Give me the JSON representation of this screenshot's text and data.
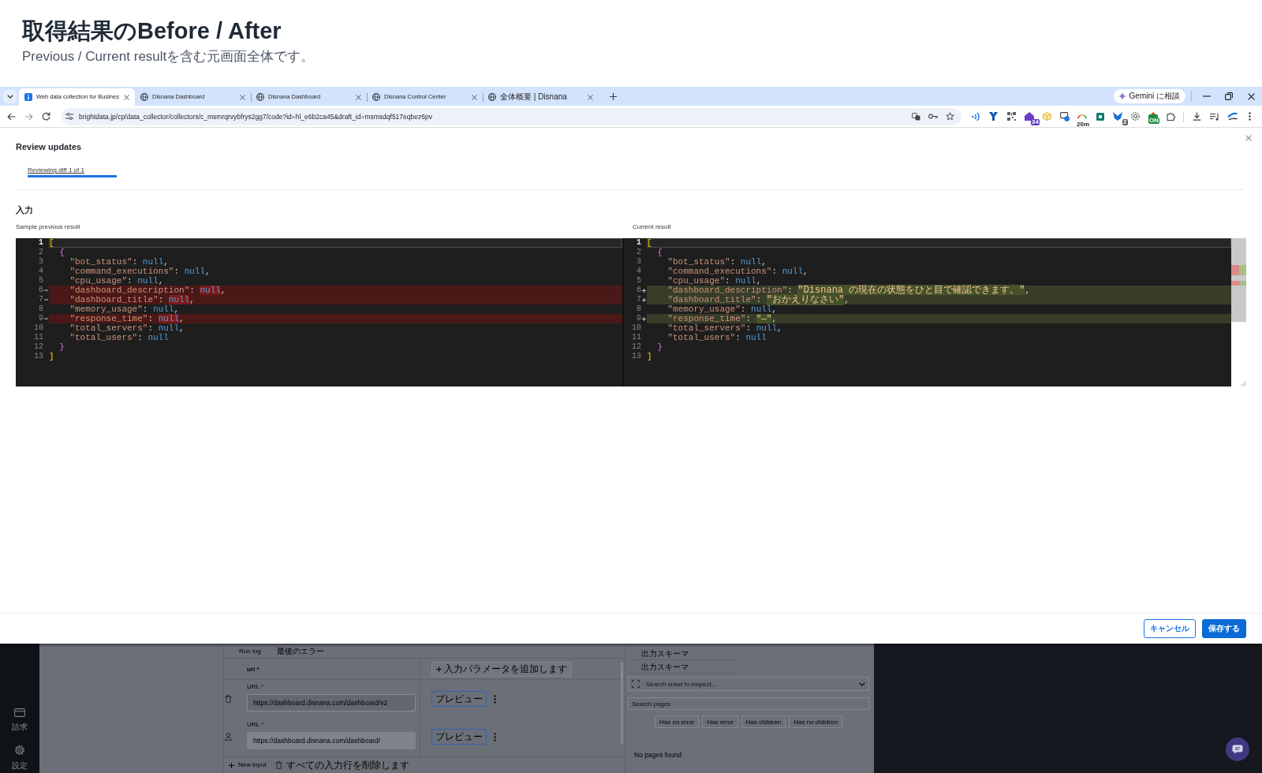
{
  "header": {
    "title": "取得結果のBefore / After",
    "subtitle": "Previous / Current resultを含む元画面全体です。"
  },
  "browser": {
    "tabs": [
      {
        "title": "Web data collection for Busines",
        "kind": "info",
        "selected": true
      },
      {
        "title": "Disnana Dashboard",
        "kind": "globe",
        "selected": false
      },
      {
        "title": "Disnana Dashboard",
        "kind": "globe",
        "selected": false
      },
      {
        "title": "Disnana Control Center",
        "kind": "globe",
        "selected": false
      },
      {
        "title": "全体概要 | Disnana",
        "kind": "globe",
        "selected": false
      }
    ],
    "assistant_button": "Gemini に相談",
    "url": "brightdata.jp/cp/data_collector/collectors/c_msmrqrvybfrys2gg7/code?id=hl_e6b2ca45&draft_id=msmsdqf517eqbez6pv",
    "extensions": [
      {
        "kind": "signal"
      },
      {
        "kind": "funnel"
      },
      {
        "kind": "qr"
      },
      {
        "kind": "house",
        "badge": "34"
      },
      {
        "kind": "box"
      },
      {
        "kind": "monitor"
      },
      {
        "kind": "gauge",
        "badge": "20m"
      },
      {
        "kind": "square"
      },
      {
        "kind": "butterfly",
        "badge": "2"
      },
      {
        "kind": "flower"
      },
      {
        "kind": "toggle",
        "badge": "ON"
      },
      {
        "kind": "puzzle"
      }
    ]
  },
  "modal": {
    "title": "Review updates",
    "tabs": [
      {
        "label": "Reviewing diff 1 of 1",
        "selected": true
      }
    ],
    "section_title": "入力",
    "panes": [
      {
        "label": "Sample previous result",
        "lines": [
          {
            "number": "1",
            "current": true,
            "kind": "unchanged",
            "tokens": [
              {
                "kind": "bracket",
                "text": "[",
                "highlight": false
              }
            ]
          },
          {
            "number": "2",
            "current": false,
            "kind": "unchanged",
            "tokens": [
              {
                "kind": "brace",
                "text": "  {",
                "highlight": false
              }
            ]
          },
          {
            "number": "3",
            "current": false,
            "kind": "unchanged",
            "tokens": [
              {
                "kind": "key",
                "text": "    \"bot_status\"",
                "highlight": false
              },
              {
                "kind": "punct",
                "text": ": ",
                "highlight": false
              },
              {
                "kind": "null",
                "text": "null",
                "highlight": false
              },
              {
                "kind": "punct",
                "text": ",",
                "highlight": false
              }
            ]
          },
          {
            "number": "4",
            "current": false,
            "kind": "unchanged",
            "tokens": [
              {
                "kind": "key",
                "text": "    \"command_executions\"",
                "highlight": false
              },
              {
                "kind": "punct",
                "text": ": ",
                "highlight": false
              },
              {
                "kind": "null",
                "text": "null",
                "highlight": false
              },
              {
                "kind": "punct",
                "text": ",",
                "highlight": false
              }
            ]
          },
          {
            "number": "5",
            "current": false,
            "kind": "unchanged",
            "tokens": [
              {
                "kind": "key",
                "text": "    \"cpu_usage\"",
                "highlight": false
              },
              {
                "kind": "punct",
                "text": ": ",
                "highlight": false
              },
              {
                "kind": "null",
                "text": "null",
                "highlight": false
              },
              {
                "kind": "punct",
                "text": ",",
                "highlight": false
              }
            ]
          },
          {
            "number": "6",
            "current": false,
            "kind": "removed",
            "tokens": [
              {
                "kind": "key",
                "text": "    \"dashboard_description\"",
                "highlight": false
              },
              {
                "kind": "punct",
                "text": ": ",
                "highlight": false
              },
              {
                "kind": "null",
                "text": "null",
                "highlight": true
              },
              {
                "kind": "punct",
                "text": ",",
                "highlight": false
              }
            ]
          },
          {
            "number": "7",
            "current": false,
            "kind": "removed",
            "tokens": [
              {
                "kind": "key",
                "text": "    \"dashboard_title\"",
                "highlight": false
              },
              {
                "kind": "punct",
                "text": ": ",
                "highlight": false
              },
              {
                "kind": "null",
                "text": "null",
                "highlight": true
              },
              {
                "kind": "punct",
                "text": ",",
                "highlight": false
              }
            ]
          },
          {
            "number": "8",
            "current": false,
            "kind": "unchanged",
            "tokens": [
              {
                "kind": "key",
                "text": "    \"memory_usage\"",
                "highlight": false
              },
              {
                "kind": "punct",
                "text": ": ",
                "highlight": false
              },
              {
                "kind": "null",
                "text": "null",
                "highlight": false
              },
              {
                "kind": "punct",
                "text": ",",
                "highlight": false
              }
            ]
          },
          {
            "number": "9",
            "current": false,
            "kind": "removed",
            "tokens": [
              {
                "kind": "key",
                "text": "    \"response_time\"",
                "highlight": false
              },
              {
                "kind": "punct",
                "text": ": ",
                "highlight": false
              },
              {
                "kind": "null",
                "text": "null",
                "highlight": true
              },
              {
                "kind": "punct",
                "text": ",",
                "highlight": false
              }
            ]
          },
          {
            "number": "10",
            "current": false,
            "kind": "unchanged",
            "tokens": [
              {
                "kind": "key",
                "text": "    \"total_servers\"",
                "highlight": false
              },
              {
                "kind": "punct",
                "text": ": ",
                "highlight": false
              },
              {
                "kind": "null",
                "text": "null",
                "highlight": false
              },
              {
                "kind": "punct",
                "text": ",",
                "highlight": false
              }
            ]
          },
          {
            "number": "11",
            "current": false,
            "kind": "unchanged",
            "tokens": [
              {
                "kind": "key",
                "text": "    \"total_users\"",
                "highlight": false
              },
              {
                "kind": "punct",
                "text": ": ",
                "highlight": false
              },
              {
                "kind": "null",
                "text": "null",
                "highlight": false
              }
            ]
          },
          {
            "number": "12",
            "current": false,
            "kind": "unchanged",
            "tokens": [
              {
                "kind": "brace",
                "text": "  }",
                "highlight": false
              }
            ]
          },
          {
            "number": "13",
            "current": false,
            "kind": "unchanged",
            "tokens": [
              {
                "kind": "bracket",
                "text": "]",
                "highlight": false
              }
            ]
          }
        ]
      },
      {
        "label": "Current result",
        "lines": [
          {
            "number": "1",
            "current": true,
            "kind": "unchanged",
            "tokens": [
              {
                "kind": "bracket",
                "text": "[",
                "highlight": false
              }
            ]
          },
          {
            "number": "2",
            "current": false,
            "kind": "unchanged",
            "tokens": [
              {
                "kind": "brace",
                "text": "  {",
                "highlight": false
              }
            ]
          },
          {
            "number": "3",
            "current": false,
            "kind": "unchanged",
            "tokens": [
              {
                "kind": "key",
                "text": "    \"bot_status\"",
                "highlight": false
              },
              {
                "kind": "punct",
                "text": ": ",
                "highlight": false
              },
              {
                "kind": "null",
                "text": "null",
                "highlight": false
              },
              {
                "kind": "punct",
                "text": ",",
                "highlight": false
              }
            ]
          },
          {
            "number": "4",
            "current": false,
            "kind": "unchanged",
            "tokens": [
              {
                "kind": "key",
                "text": "    \"command_executions\"",
                "highlight": false
              },
              {
                "kind": "punct",
                "text": ": ",
                "highlight": false
              },
              {
                "kind": "null",
                "text": "null",
                "highlight": false
              },
              {
                "kind": "punct",
                "text": ",",
                "highlight": false
              }
            ]
          },
          {
            "number": "5",
            "current": false,
            "kind": "unchanged",
            "tokens": [
              {
                "kind": "key",
                "text": "    \"cpu_usage\"",
                "highlight": false
              },
              {
                "kind": "punct",
                "text": ": ",
                "highlight": false
              },
              {
                "kind": "null",
                "text": "null",
                "highlight": false
              },
              {
                "kind": "punct",
                "text": ",",
                "highlight": false
              }
            ]
          },
          {
            "number": "6",
            "current": false,
            "kind": "added",
            "tokens": [
              {
                "kind": "key",
                "text": "    \"dashboard_description\"",
                "highlight": false
              },
              {
                "kind": "punct",
                "text": ": ",
                "highlight": false
              },
              {
                "kind": "string",
                "text": "\"Disnana の現在の状態をひと目で確認できます。\"",
                "highlight": true
              },
              {
                "kind": "punct",
                "text": ",",
                "highlight": false
              }
            ]
          },
          {
            "number": "7",
            "current": false,
            "kind": "added",
            "tokens": [
              {
                "kind": "key",
                "text": "    \"dashboard_title\"",
                "highlight": false
              },
              {
                "kind": "punct",
                "text": ": ",
                "highlight": false
              },
              {
                "kind": "string",
                "text": "\"おかえりなさい\"",
                "highlight": true
              },
              {
                "kind": "punct",
                "text": ",",
                "highlight": false
              }
            ]
          },
          {
            "number": "8",
            "current": false,
            "kind": "unchanged",
            "tokens": [
              {
                "kind": "key",
                "text": "    \"memory_usage\"",
                "highlight": false
              },
              {
                "kind": "punct",
                "text": ": ",
                "highlight": false
              },
              {
                "kind": "null",
                "text": "null",
                "highlight": false
              },
              {
                "kind": "punct",
                "text": ",",
                "highlight": false
              }
            ]
          },
          {
            "number": "9",
            "current": false,
            "kind": "added",
            "tokens": [
              {
                "kind": "key",
                "text": "    \"response_time\"",
                "highlight": false
              },
              {
                "kind": "punct",
                "text": ": ",
                "highlight": false
              },
              {
                "kind": "string",
                "text": "\"—\"",
                "highlight": true
              },
              {
                "kind": "punct",
                "text": ",",
                "highlight": false
              }
            ]
          },
          {
            "number": "10",
            "current": false,
            "kind": "unchanged",
            "tokens": [
              {
                "kind": "key",
                "text": "    \"total_servers\"",
                "highlight": false
              },
              {
                "kind": "punct",
                "text": ": ",
                "highlight": false
              },
              {
                "kind": "null",
                "text": "null",
                "highlight": false
              },
              {
                "kind": "punct",
                "text": ",",
                "highlight": false
              }
            ]
          },
          {
            "number": "11",
            "current": false,
            "kind": "unchanged",
            "tokens": [
              {
                "kind": "key",
                "text": "    \"total_users\"",
                "highlight": false
              },
              {
                "kind": "punct",
                "text": ": ",
                "highlight": false
              },
              {
                "kind": "null",
                "text": "null",
                "highlight": false
              }
            ]
          },
          {
            "number": "12",
            "current": false,
            "kind": "unchanged",
            "tokens": [
              {
                "kind": "brace",
                "text": "  }",
                "highlight": false
              }
            ]
          },
          {
            "number": "13",
            "current": false,
            "kind": "unchanged",
            "tokens": [
              {
                "kind": "bracket",
                "text": "]",
                "highlight": false
              }
            ]
          }
        ]
      }
    ],
    "buttons": [
      {
        "label": "キャンセル",
        "kind": "outline"
      },
      {
        "label": "保存する",
        "kind": "primary"
      }
    ]
  },
  "background_app": {
    "sidebar": [
      {
        "kind": "card",
        "label": "請求"
      },
      {
        "kind": "gear",
        "label": "設定"
      }
    ],
    "input_panel": {
      "tabs": [
        "Run log",
        "最後のエラー"
      ],
      "column_header": "url *",
      "add_parameter": "入力パラメータを追加します",
      "rows": [
        {
          "kind": "trash",
          "label": "URL",
          "required_mark": "*",
          "value": "https://dashboard.disnana.com/dashboard/v2",
          "disabled": false,
          "preview": "プレビュー"
        },
        {
          "kind": "person",
          "label": "URL",
          "required_mark": "*",
          "value": "https://dashboard.disnana.com/dashboard/",
          "disabled": true,
          "preview": "プレビュー"
        }
      ],
      "new_input": "New input",
      "delete_all": "すべての入力行を削除します"
    },
    "output_panel": {
      "schema_tabs": [
        "出力スキーマ",
        "出力スキーマ"
      ],
      "crawl_search": {
        "placeholder": "Search crawl to inspect..."
      },
      "page_search": {
        "placeholder": "Search pages"
      },
      "filters": [
        "Has no error",
        "Has error",
        "Has children",
        "Has no children"
      ],
      "empty_message": "No pages found"
    }
  }
}
